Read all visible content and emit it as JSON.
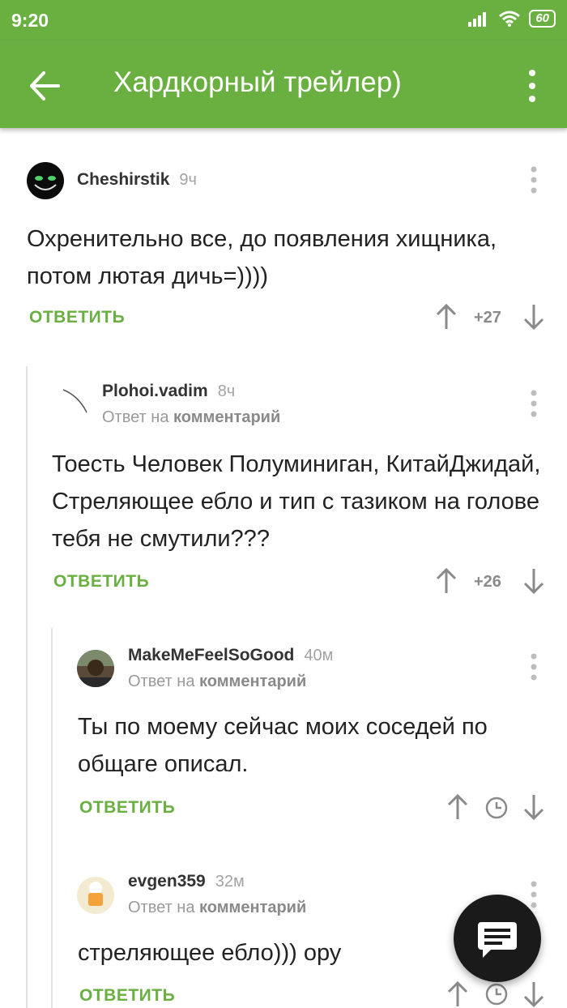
{
  "status": {
    "time": "9:20",
    "battery": "60"
  },
  "appbar": {
    "title": "Хардкорный трейлер)"
  },
  "comments": [
    {
      "author": "Cheshirstik",
      "time": "9ч",
      "text": "Охренительно все, до появления хищника, потом лютая дичь=))))",
      "reply_label": "ОТВЕТИТЬ",
      "rating": "+27"
    },
    {
      "author": "Plohoi.vadim",
      "time": "8ч",
      "reply_prefix": "Ответ на",
      "reply_target": "комментарий",
      "text": "Тоесть Человек Полуминиган, КитайДжидай, Стреляющее ебло и тип с тазиком на голове тебя не смутили???",
      "reply_label": "ОТВЕТИТЬ",
      "rating": "+26"
    },
    {
      "author": "MakeMeFeelSoGood",
      "time": "40м",
      "reply_prefix": "Ответ на",
      "reply_target": "комментарий",
      "text": "Ты по моему сейчас моих соседей по общаге описал.",
      "reply_label": "ОТВЕТИТЬ"
    },
    {
      "author": "evgen359",
      "time": "32м",
      "reply_prefix": "Ответ на",
      "reply_target": "комментарий",
      "text": "стреляющее ебло))) ору",
      "reply_label": "ОТВЕТИТЬ"
    }
  ],
  "colors": {
    "accent": "#6ab041",
    "fab": "#1a1a1a"
  },
  "icons": [
    "back-arrow-icon",
    "more-vert-icon",
    "arrow-up-icon",
    "arrow-down-icon",
    "clock-icon",
    "chat-icon",
    "signal-icon",
    "wifi-icon"
  ]
}
